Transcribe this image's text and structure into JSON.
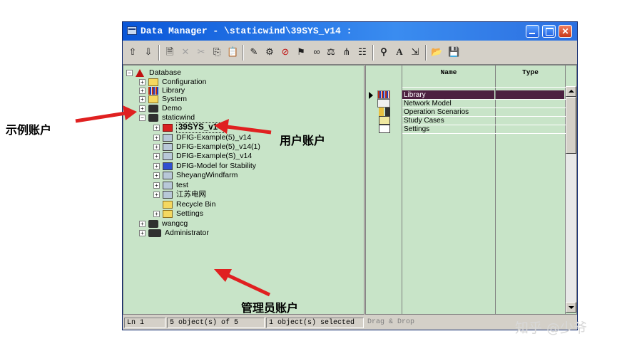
{
  "window": {
    "title": "Data Manager - \\staticwind\\39SYS_v14 :",
    "controls": [
      "minimize",
      "maximize",
      "close"
    ]
  },
  "toolbar": {
    "icons": [
      "move-up-icon",
      "move-down-icon",
      "new-object-icon",
      "delete-icon",
      "cut-icon",
      "copy-icon",
      "paste-icon",
      "edit-icon",
      "settings-icon",
      "forbidden-icon",
      "activate-icon",
      "link-icon",
      "compare-icon",
      "tree-icon",
      "details-icon",
      "find-icon",
      "font-icon",
      "export-icon",
      "open-icon",
      "save-icon"
    ]
  },
  "tree": {
    "nodes": [
      {
        "label": "Database",
        "exp": "−",
        "icon": "database-icon"
      },
      {
        "label": "Configuration",
        "exp": "+",
        "icon": "folder-icon"
      },
      {
        "label": "Library",
        "exp": "+",
        "icon": "library-icon"
      },
      {
        "label": "System",
        "exp": "+",
        "icon": "folder-icon"
      },
      {
        "label": "Demo",
        "exp": "+",
        "icon": "user-icon"
      },
      {
        "label": "staticwind",
        "exp": "−",
        "icon": "user-icon"
      },
      {
        "label": "39SYS_v14",
        "exp": "+",
        "icon": "active-project-icon"
      },
      {
        "label": "DFIG-Example(5)_v14",
        "exp": "+",
        "icon": "project-icon"
      },
      {
        "label": "DFIG-Example(5)_v14(1)",
        "exp": "+",
        "icon": "project-icon"
      },
      {
        "label": "DFIG-Example(S)_v14",
        "exp": "+",
        "icon": "project-icon"
      },
      {
        "label": "DFIG-Model for Stability",
        "exp": "+",
        "icon": "project-icon"
      },
      {
        "label": "SheyangWindfarm",
        "exp": "+",
        "icon": "project-icon"
      },
      {
        "label": "test",
        "exp": "+",
        "icon": "project-icon"
      },
      {
        "label": "江苏电网",
        "exp": "+",
        "icon": "project-icon"
      },
      {
        "label": "Recycle Bin",
        "exp": "",
        "icon": "folder-icon"
      },
      {
        "label": "Settings",
        "exp": "+",
        "icon": "folder-icon"
      },
      {
        "label": "wangcg",
        "exp": "+",
        "icon": "user-icon"
      },
      {
        "label": "Administrator",
        "exp": "+",
        "icon": "admin-icon"
      }
    ]
  },
  "right_panel": {
    "columns": [
      "Name",
      "Type"
    ],
    "rows": [
      {
        "name": "Library",
        "type": "",
        "icon": "library-icon",
        "selected": true
      },
      {
        "name": "Network Model",
        "type": "",
        "icon": "network-model-icon"
      },
      {
        "name": "Operation Scenarios",
        "type": "",
        "icon": "operation-scenarios-icon"
      },
      {
        "name": "Study Cases",
        "type": "",
        "icon": "study-cases-icon"
      },
      {
        "name": "Settings",
        "type": "",
        "icon": "settings-folder-icon"
      }
    ]
  },
  "status": {
    "line": "Ln 1",
    "objects": "5 object(s) of 5",
    "selected": "1 object(s) selected",
    "hint": "Drag & Drop"
  },
  "annotations": {
    "demo_account": "示例账户",
    "user_account": "用户账户",
    "admin_account": "管理员账户",
    "arrow_color": "#e02020"
  },
  "watermark": "知乎 @少爷"
}
